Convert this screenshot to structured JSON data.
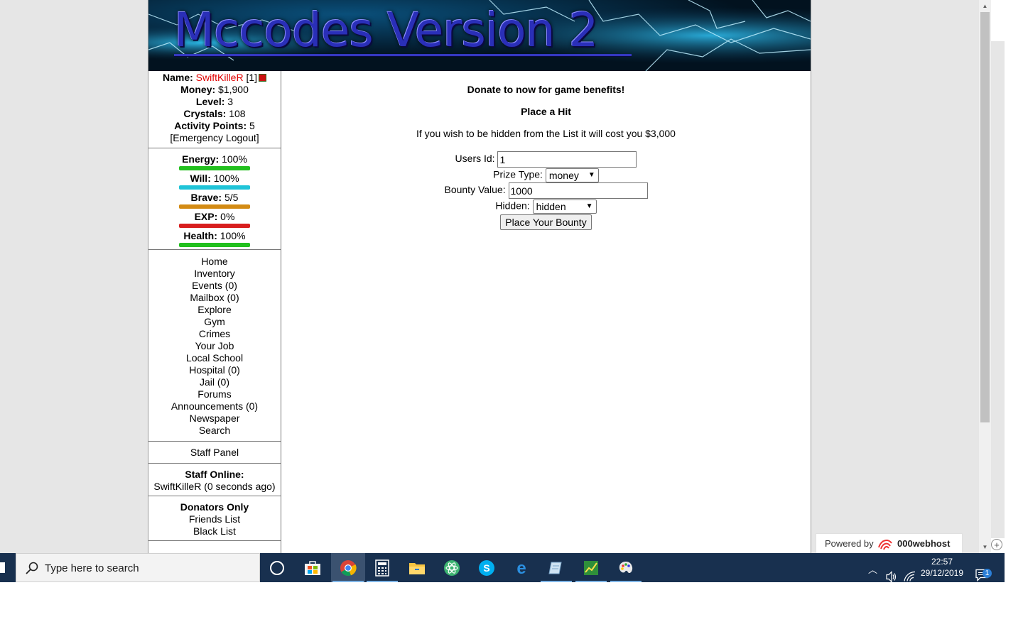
{
  "banner": {
    "title": "Mccodes Version 2"
  },
  "user": {
    "name_label": "Name:",
    "name": "SwiftKilleR",
    "id": "[1]",
    "money_label": "Money:",
    "money": "$1,900",
    "level_label": "Level:",
    "level": "3",
    "crystals_label": "Crystals:",
    "crystals": "108",
    "activity_label": "Activity Points:",
    "activity": "5",
    "logout": "[Emergency Logout]"
  },
  "bars": [
    {
      "label": "Energy:",
      "value": "100%",
      "color": "#22c01e"
    },
    {
      "label": "Will:",
      "value": "100%",
      "color": "#1fc4d8"
    },
    {
      "label": "Brave:",
      "value": "5/5",
      "color": "#d38b14"
    },
    {
      "label": "EXP:",
      "value": "0%",
      "color": "#d81e1e"
    },
    {
      "label": "Health:",
      "value": "100%",
      "color": "#22c01e"
    }
  ],
  "nav": [
    "Home",
    "Inventory",
    "Events (0)",
    "Mailbox (0)",
    "Explore",
    "Gym",
    "Crimes",
    "Your Job",
    "Local School",
    "Hospital (0)",
    "Jail (0)",
    "Forums",
    "Announcements (0)",
    "Newspaper",
    "Search"
  ],
  "staff_panel": "Staff Panel",
  "staff_online": {
    "title": "Staff Online:",
    "entry": "SwiftKilleR (0 seconds ago)"
  },
  "donators": {
    "title": "Donators Only",
    "friends": "Friends List",
    "black": "Black List"
  },
  "content": {
    "donate": "Donate to now for game benefits!",
    "heading": "Place a Hit",
    "hidden_note": "If you wish to be hidden from the List it will cost you $3,000",
    "users_id_label": "Users Id:",
    "users_id_value": "1",
    "prize_label": "Prize Type:",
    "prize_value": "money",
    "bounty_label": "Bounty Value:",
    "bounty_value": "1000",
    "hidden_label": "Hidden:",
    "hidden_value": "hidden",
    "submit": "Place Your Bounty"
  },
  "powered": {
    "prefix": "Powered by",
    "brand": "000webhost"
  },
  "taskbar": {
    "search_placeholder": "Type here to search",
    "time": "22:57",
    "date": "29/12/2019",
    "notifications": "1"
  },
  "colors": {
    "name": "#e00000",
    "taskbar": "#18304f"
  }
}
